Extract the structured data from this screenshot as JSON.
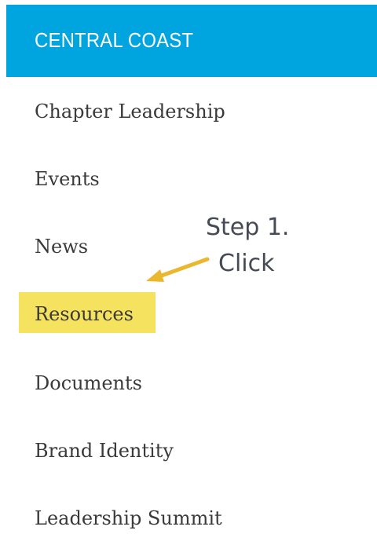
{
  "header": {
    "title": "CENTRAL COAST",
    "background_color": "#00a5e0"
  },
  "nav": {
    "items": [
      {
        "label": "Chapter Leadership"
      },
      {
        "label": "Events"
      },
      {
        "label": "News"
      },
      {
        "label": "Resources",
        "highlighted": true
      },
      {
        "label": "Documents"
      },
      {
        "label": "Brand Identity"
      },
      {
        "label": "Leadership Summit"
      }
    ],
    "highlight_color": "#f5e25e"
  },
  "annotation": {
    "line1": "Step 1.",
    "line2": "Click",
    "arrow_color": "#eab82e",
    "points_to": "Resources"
  }
}
